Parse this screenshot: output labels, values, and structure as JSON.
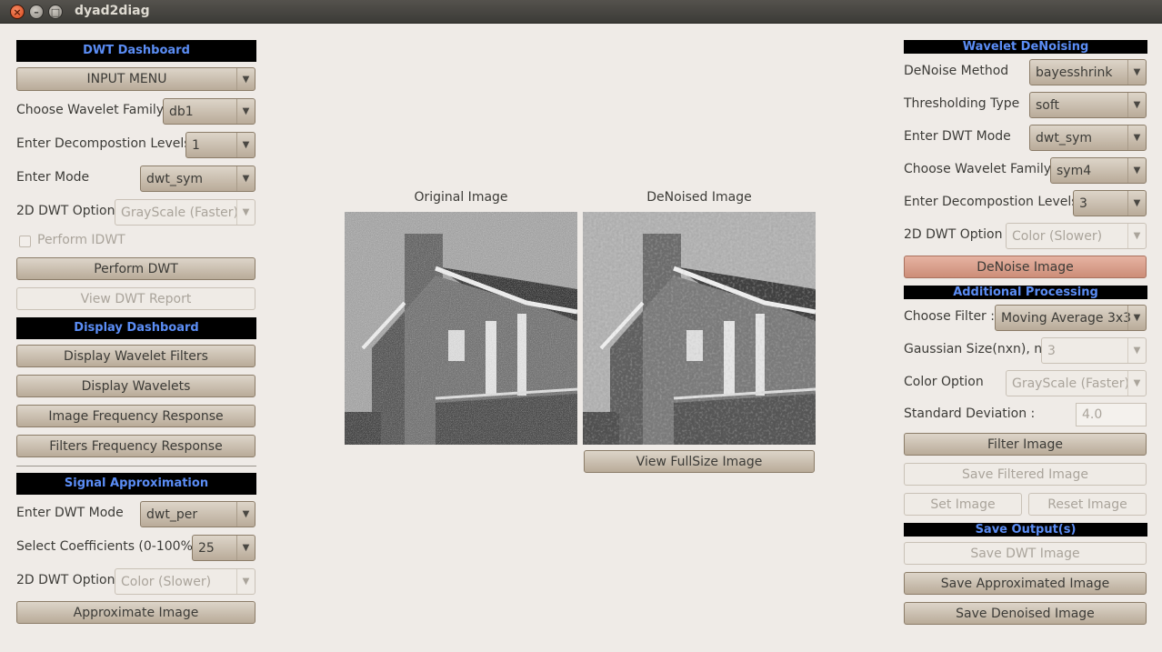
{
  "window": {
    "title": "dyad2diag",
    "close_glyph": "×",
    "min_glyph": "–",
    "max_glyph": "□"
  },
  "left": {
    "dwt_dashboard": {
      "header": "DWT Dashboard",
      "input_menu": "INPUT MENU",
      "wavelet_family_label": "Choose Wavelet Family",
      "wavelet_family_value": "db1",
      "levels_label": "Enter Decompostion Levels",
      "levels_value": "1",
      "mode_label": "Enter Mode",
      "mode_value": "dwt_sym",
      "option_label": "2D DWT Option",
      "option_value": "GrayScale (Faster)",
      "idwt_label": "Perform IDWT",
      "perform_dwt": "Perform DWT",
      "view_report": "View DWT Report"
    },
    "display_dashboard": {
      "header": "Display Dashboard",
      "buttons": [
        "Display Wavelet Filters",
        "Display Wavelets",
        "Image Frequency Response",
        "Filters Frequency Response"
      ]
    },
    "signal_approximation": {
      "header": "Signal Approximation",
      "mode_label": "Enter DWT Mode",
      "mode_value": "dwt_per",
      "coeff_label": "Select Coefficients (0-100%)",
      "coeff_value": "25",
      "option_label": "2D DWT Option",
      "option_value": "Color (Slower)",
      "approximate": "Approximate Image"
    }
  },
  "center": {
    "original_label": "Original Image",
    "denoised_label": "DeNoised Image",
    "view_fullsize": "View FullSize Image"
  },
  "right": {
    "wavelet_denoising": {
      "header": "Wavelet DeNoising",
      "method_label": "DeNoise Method",
      "method_value": "bayesshrink",
      "threshold_label": "Thresholding Type",
      "threshold_value": "soft",
      "mode_label": "Enter DWT Mode",
      "mode_value": "dwt_sym",
      "family_label": "Choose Wavelet Family",
      "family_value": "sym4",
      "levels_label": "Enter Decompostion Levels",
      "levels_value": "3",
      "option_label": "2D DWT Option",
      "option_value": "Color (Slower)",
      "denoise": "DeNoise Image"
    },
    "additional_processing": {
      "header": "Additional Processing",
      "filter_label": "Choose Filter :",
      "filter_value": "Moving Average 3x3",
      "gauss_label": "Gaussian Size(nxn), n:",
      "gauss_value": "3",
      "color_label": "Color Option",
      "color_value": "GrayScale (Faster)",
      "stddev_label": "Standard Deviation :",
      "stddev_value": "4.0",
      "filter_image": "Filter Image",
      "save_filtered": "Save Filtered Image",
      "set_image": "Set Image",
      "reset_image": "Reset Image"
    },
    "save_outputs": {
      "header": "Save Output(s)",
      "save_dwt": "Save DWT Image",
      "save_approx": "Save Approximated Image",
      "save_denoised": "Save Denoised Image"
    }
  },
  "icons": {
    "dropdown_arrow": "▼"
  }
}
